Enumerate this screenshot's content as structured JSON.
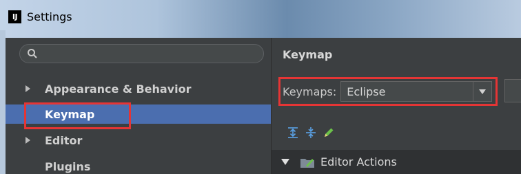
{
  "window": {
    "logo_text": "IJ",
    "title": "Settings"
  },
  "sidebar": {
    "search": {
      "placeholder": ""
    },
    "items": [
      {
        "label": "Appearance & Behavior",
        "expandable": true,
        "selected": false
      },
      {
        "label": "Keymap",
        "expandable": false,
        "selected": true
      },
      {
        "label": "Editor",
        "expandable": true,
        "selected": false
      },
      {
        "label": "Plugins",
        "expandable": false,
        "selected": false
      }
    ]
  },
  "main": {
    "title": "Keymap",
    "keymaps_label": "Keymaps:",
    "keymap_selected": "Eclipse",
    "toolbar": [
      "expand-all-icon",
      "collapse-all-icon",
      "edit-pencil-icon"
    ],
    "tree": [
      {
        "label": "Editor Actions",
        "expanded": true
      }
    ]
  },
  "colors": {
    "selection": "#4b6eaf",
    "highlight_box": "#e53535",
    "panel_bg": "#3c3f41"
  }
}
